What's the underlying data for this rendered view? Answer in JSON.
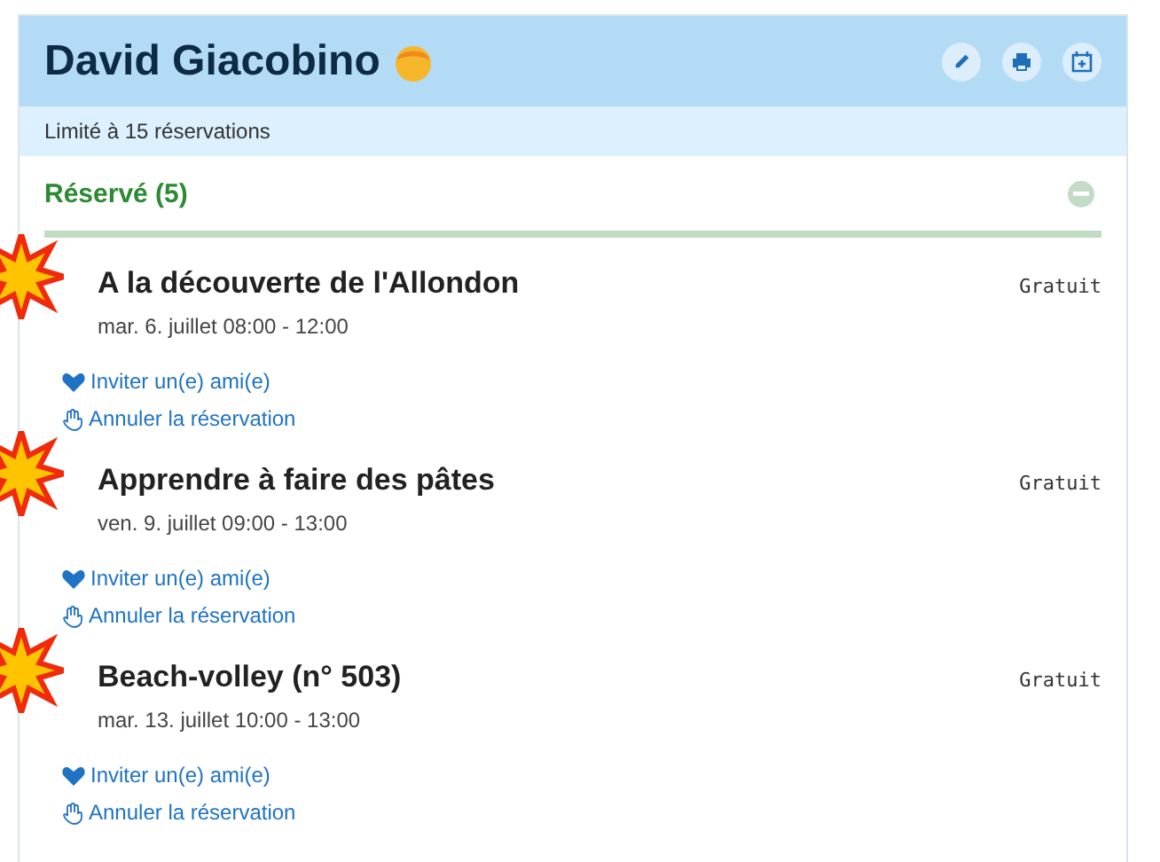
{
  "header": {
    "title": "David Giacobino",
    "actions": [
      {
        "kind": "edit"
      },
      {
        "kind": "print"
      },
      {
        "kind": "calendar-add"
      }
    ]
  },
  "limit": "Limité à 15 réservations",
  "section": {
    "title": "Réservé (5)",
    "expanded": true
  },
  "items": [
    {
      "title": "A la découverte de l'Allondon",
      "date": "mar. 6. juillet 08:00 - 12:00",
      "price": "Gratuit",
      "invite": "Inviter un(e) ami(e)",
      "cancel": "Annuler la réservation"
    },
    {
      "title": "Apprendre à faire des pâtes",
      "date": "ven. 9. juillet 09:00 - 13:00",
      "price": "Gratuit",
      "invite": "Inviter un(e) ami(e)",
      "cancel": "Annuler la réservation"
    },
    {
      "title": "Beach-volley (n° 503)",
      "date": "mar. 13. juillet 10:00 - 13:00",
      "price": "Gratuit",
      "invite": "Inviter un(e) ami(e)",
      "cancel": "Annuler la réservation"
    }
  ]
}
